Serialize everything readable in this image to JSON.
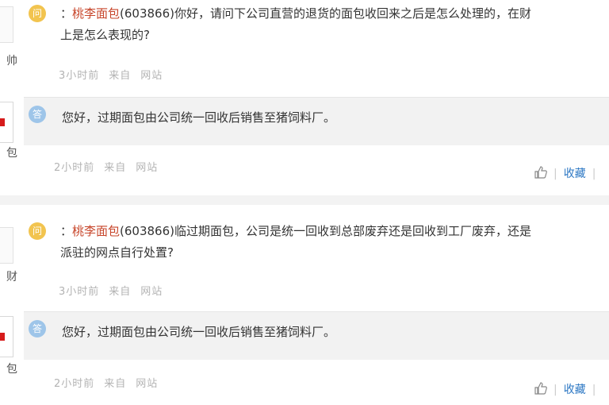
{
  "items": [
    {
      "side_top": "帅",
      "side_bottom": "包",
      "question": {
        "badge": "问",
        "colon": "：",
        "company": "桃李面包",
        "code": "(603866)",
        "line1": "你好，请问下公司直营的退货的面包收回来之后是怎么处理的，在财",
        "line2": "上是怎么表现的?",
        "time": "3小时前",
        "from": "来自",
        "source": "网站"
      },
      "answer": {
        "badge": "答",
        "text": "您好，过期面包由公司统一回收后销售至猪饲料厂。",
        "time": "2小时前",
        "from": "来自",
        "source": "网站",
        "favorite": "收藏"
      }
    },
    {
      "side_top": "财",
      "side_bottom": "包",
      "question": {
        "badge": "问",
        "colon": "：",
        "company": "桃李面包",
        "code": "(603866)",
        "line1": "临过期面包，公司是统一回收到总部废弃还是回收到工厂废弃，还是",
        "line2": "派驻的网点自行处置?",
        "time": "3小时前",
        "from": "来自",
        "source": "网站"
      },
      "answer": {
        "badge": "答",
        "text": "您好，过期面包由公司统一回收后销售至猪饲料厂。",
        "time": "2小时前",
        "from": "来自",
        "source": "网站",
        "favorite": "收藏"
      }
    }
  ]
}
